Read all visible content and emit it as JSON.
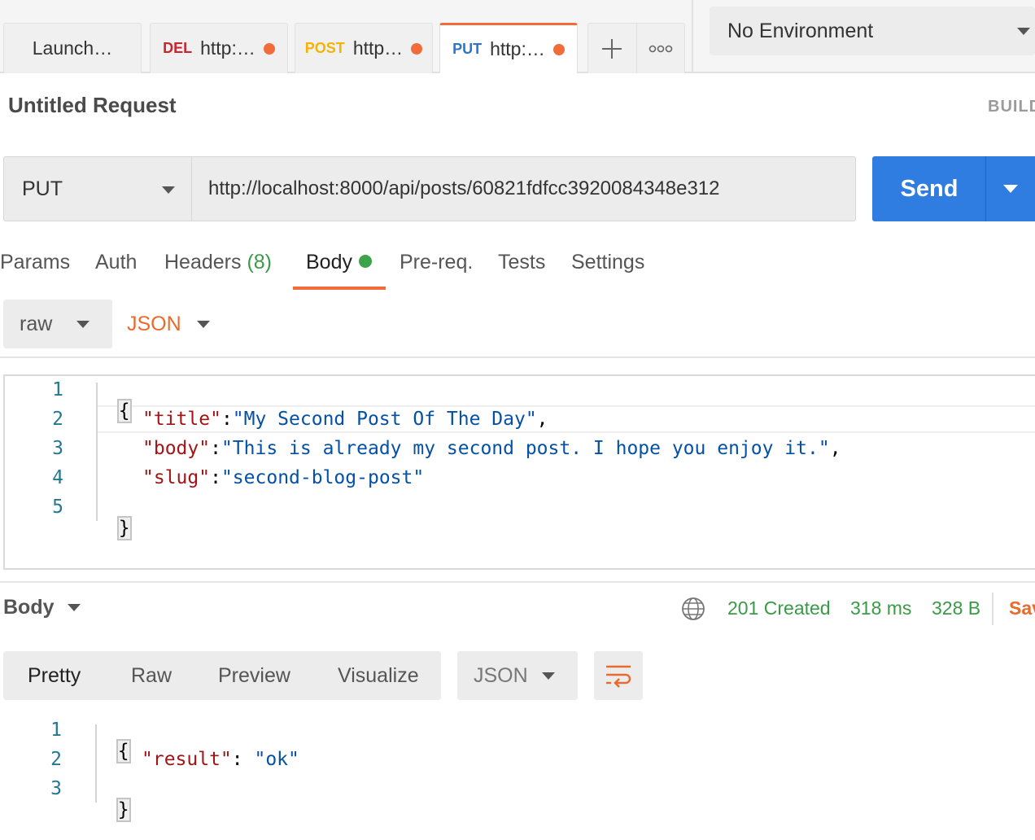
{
  "tabs": [
    {
      "method": "",
      "method_color": "",
      "title": "Launch…",
      "unsaved": false,
      "active": false
    },
    {
      "method": "DEL",
      "method_color": "#c6262e",
      "title": "http:…",
      "unsaved": true,
      "active": false
    },
    {
      "method": "POST",
      "method_color": "#f4b400",
      "title": "http…",
      "unsaved": true,
      "active": false
    },
    {
      "method": "PUT",
      "method_color": "#2c76c9",
      "title": "http:…",
      "unsaved": true,
      "active": true
    }
  ],
  "tab_tools": {
    "new_tab_icon": "plus-icon",
    "more_icon": "ellipsis-icon"
  },
  "environment": {
    "selected": "No Environment"
  },
  "request": {
    "title": "Untitled Request",
    "build_label": "BUILD",
    "method": "PUT",
    "url": "http://localhost:8000/api/posts/60821fdfcc3920084348e312",
    "send_label": "Send"
  },
  "request_tabs": {
    "params": "Params",
    "auth": "Auth",
    "headers": "Headers",
    "headers_count": "(8)",
    "body": "Body",
    "prereq": "Pre-req.",
    "tests": "Tests",
    "settings": "Settings",
    "active": "body"
  },
  "body_mode": {
    "mode": "raw",
    "format": "JSON"
  },
  "request_body": {
    "line_numbers": [
      "1",
      "2",
      "3",
      "4",
      "5"
    ],
    "open_brace": "{",
    "close_brace": "}",
    "lines": [
      {
        "key": "\"title\"",
        "sep": ":",
        "value": "\"My Second Post Of The Day\"",
        "trail": ","
      },
      {
        "key": "\"body\"",
        "sep": ":",
        "value": "\"This is already my second post. I hope you enjoy it.\"",
        "trail": ","
      },
      {
        "key": "\"slug\"",
        "sep": ":",
        "value": "\"second-blog-post\"",
        "trail": ""
      }
    ]
  },
  "response": {
    "section_label": "Body",
    "status": "201 Created",
    "time": "318 ms",
    "size": "328 B",
    "save_label": "Save",
    "views": [
      "Pretty",
      "Raw",
      "Preview",
      "Visualize"
    ],
    "active_view": "Pretty",
    "format": "JSON",
    "line_numbers": [
      "1",
      "2",
      "3"
    ],
    "open_brace": "{",
    "close_brace": "}",
    "lines": [
      {
        "key": "\"result\"",
        "sep": ": ",
        "value": "\"ok\""
      }
    ]
  },
  "colors": {
    "accent": "#f26b3a",
    "send": "#2f7de1",
    "status_ok": "#3a9a47",
    "json_key": "#a31515",
    "json_string": "#0451a5",
    "line_number": "#237893"
  }
}
